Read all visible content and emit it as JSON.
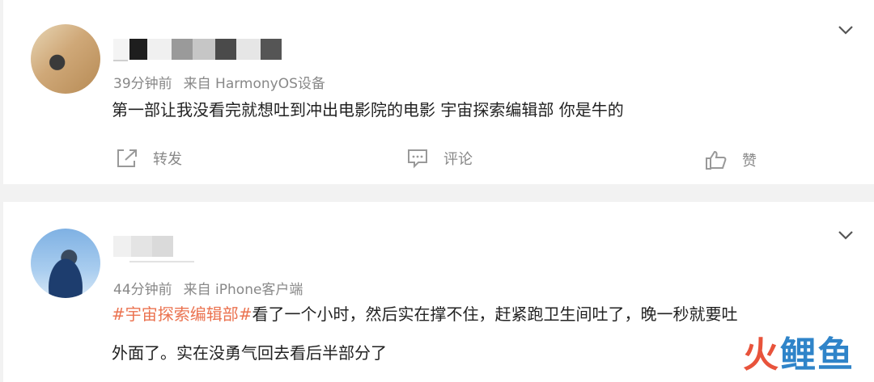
{
  "comments": [
    {
      "time": "39分钟前",
      "source": "来自 HarmonyOS设备",
      "text": "第一部让我没看完就想吐到冲出电影院的电影 宇宙探索编辑部 你是牛的",
      "actions": {
        "repost": "转发",
        "comment": "评论",
        "like": "赞"
      }
    },
    {
      "time": "44分钟前",
      "source": "来自 iPhone客户端",
      "topic": "#宇宙探索编辑部#",
      "text_line1": "看了一个小时，然后实在撑不住，赶紧跑卫生间吐了，晚一秒就要吐",
      "text_line2": "外面了。实在没勇气回去看后半部分了"
    }
  ],
  "watermark": {
    "part1": "火",
    "part2": "鲤鱼"
  },
  "colors": {
    "topic": "#eb7350",
    "background": "#f2f2f2",
    "card": "#ffffff",
    "meta": "#888888"
  },
  "icons": [
    "chevron-down-icon",
    "repost-icon",
    "comment-icon",
    "like-icon"
  ]
}
